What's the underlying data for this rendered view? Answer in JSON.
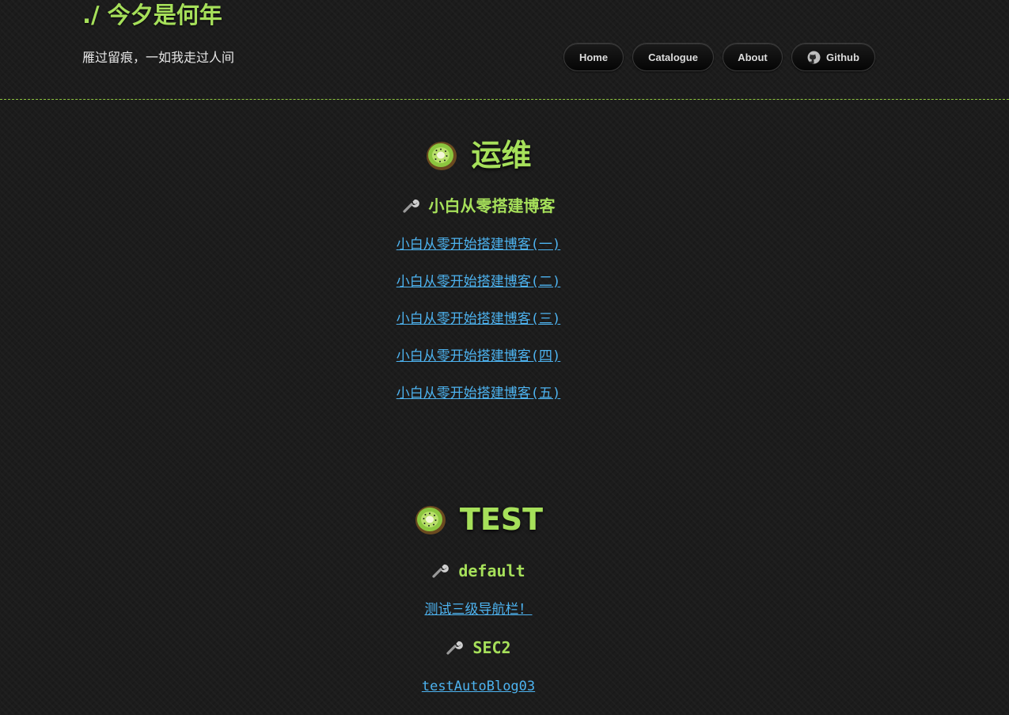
{
  "header": {
    "site_title": "./ 今夕是何年",
    "subtitle": "雁过留痕，一如我走过人间",
    "nav": [
      {
        "label": "Home"
      },
      {
        "label": "Catalogue"
      },
      {
        "label": "About"
      },
      {
        "label": "Github",
        "icon": "github-icon"
      }
    ]
  },
  "colors": {
    "accent_green": "#a6e05a",
    "link_blue": "#4db3f0",
    "background": "#1c1c1c",
    "divider": "#8fc63f"
  },
  "categories": [
    {
      "title": "运维",
      "icon": "kiwi-icon",
      "groups": [
        {
          "title": "小白从零搭建博客",
          "icon": "wrench-icon",
          "posts": [
            "小白从零开始搭建博客(一)",
            "小白从零开始搭建博客(二)",
            "小白从零开始搭建博客(三)",
            "小白从零开始搭建博客(四)",
            "小白从零开始搭建博客(五)"
          ]
        }
      ]
    },
    {
      "title": "TEST",
      "icon": "kiwi-icon",
      "groups": [
        {
          "title": "default",
          "icon": "wrench-icon",
          "posts": [
            "测试三级导航栏！"
          ]
        },
        {
          "title": "SEC2",
          "icon": "wrench-icon",
          "posts": [
            "testAutoBlog03"
          ]
        }
      ]
    }
  ]
}
